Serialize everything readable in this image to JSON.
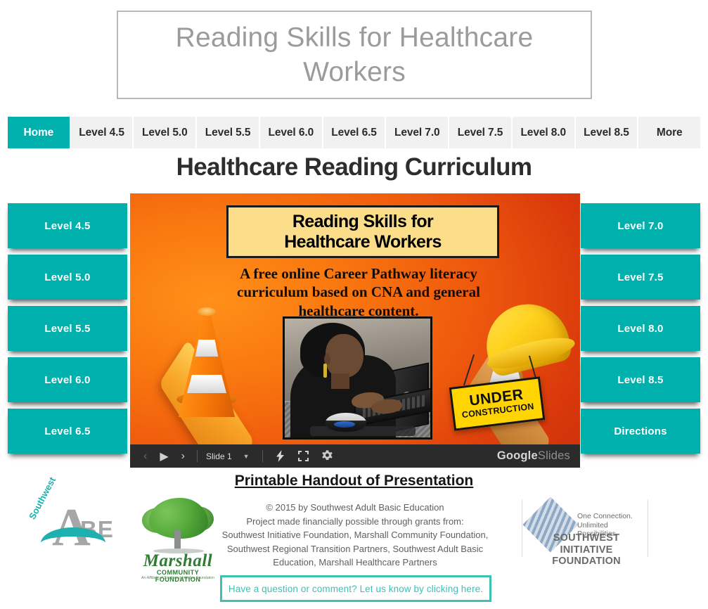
{
  "header": {
    "title": "Reading Skills for Healthcare Workers"
  },
  "nav": {
    "items": [
      {
        "label": "Home",
        "active": true
      },
      {
        "label": "Level 4.5",
        "active": false
      },
      {
        "label": "Level 5.0",
        "active": false
      },
      {
        "label": "Level 5.5",
        "active": false
      },
      {
        "label": "Level 6.0",
        "active": false
      },
      {
        "label": "Level 6.5",
        "active": false
      },
      {
        "label": "Level 7.0",
        "active": false
      },
      {
        "label": "Level 7.5",
        "active": false
      },
      {
        "label": "Level 8.0",
        "active": false
      },
      {
        "label": "Level 8.5",
        "active": false
      },
      {
        "label": "More",
        "active": false
      }
    ]
  },
  "page": {
    "title": "Healthcare Reading Curriculum",
    "handout_link": "Printable Handout of Presentation"
  },
  "left_buttons": [
    {
      "label": "Level 4.5"
    },
    {
      "label": "Level 5.0"
    },
    {
      "label": "Level 5.5"
    },
    {
      "label": "Level 6.0"
    },
    {
      "label": "Level 6.5"
    }
  ],
  "right_buttons": [
    {
      "label": "Level 7.0"
    },
    {
      "label": "Level 7.5"
    },
    {
      "label": "Level 8.0"
    },
    {
      "label": "Level 8.5"
    },
    {
      "label": "Directions"
    }
  ],
  "slide": {
    "title_line1": "Reading Skills for",
    "title_line2": "Healthcare Workers",
    "subtitle": "A free online Career Pathway literacy curriculum based on CNA and general healthcare content.",
    "sign_line1": "UNDER",
    "sign_line2": "CONSTRUCTION",
    "controls": {
      "prev_icon": "chevron-left-icon",
      "play_icon": "play-icon",
      "next_icon": "chevron-right-icon",
      "slide_label": "Slide 1",
      "caret_icon": "chevron-down-icon",
      "present_icon": "lightning-icon",
      "fullscreen_icon": "fullscreen-icon",
      "settings_icon": "gear-icon",
      "brand_primary": "Google",
      "brand_secondary": "Slides"
    }
  },
  "footer": {
    "credits": [
      "© 2015 by Southwest Adult Basic Education",
      "Project made financially possible through grants from:",
      "Southwest Initiative Foundation, Marshall Community Foundation,",
      "Southwest Regional Transition Partners, Southwest Adult Basic",
      "Education, Marshall Healthcare Partners"
    ],
    "logo_abe": {
      "southwest": "Southwest",
      "letters_be": "BE",
      "letter_a": "A"
    },
    "logo_marshall": {
      "name": "Marshall",
      "subtitle": "COMMUNITY FOUNDATION",
      "tagline": "An Affiliate of Southwest Initiative Foundation"
    },
    "logo_swif": {
      "tagline1": "One Connection.",
      "tagline2": "Unlimited Possibilities.",
      "name": "SOUTHWEST INITIATIVE FOUNDATION"
    },
    "contact": "Have a question or comment? Let us know by clicking here."
  },
  "colors": {
    "teal": "#00b0ad",
    "contact_teal": "#3fc0b4",
    "nav_bg": "#f1f1f1",
    "slide_bar": "#2b2b2b"
  }
}
